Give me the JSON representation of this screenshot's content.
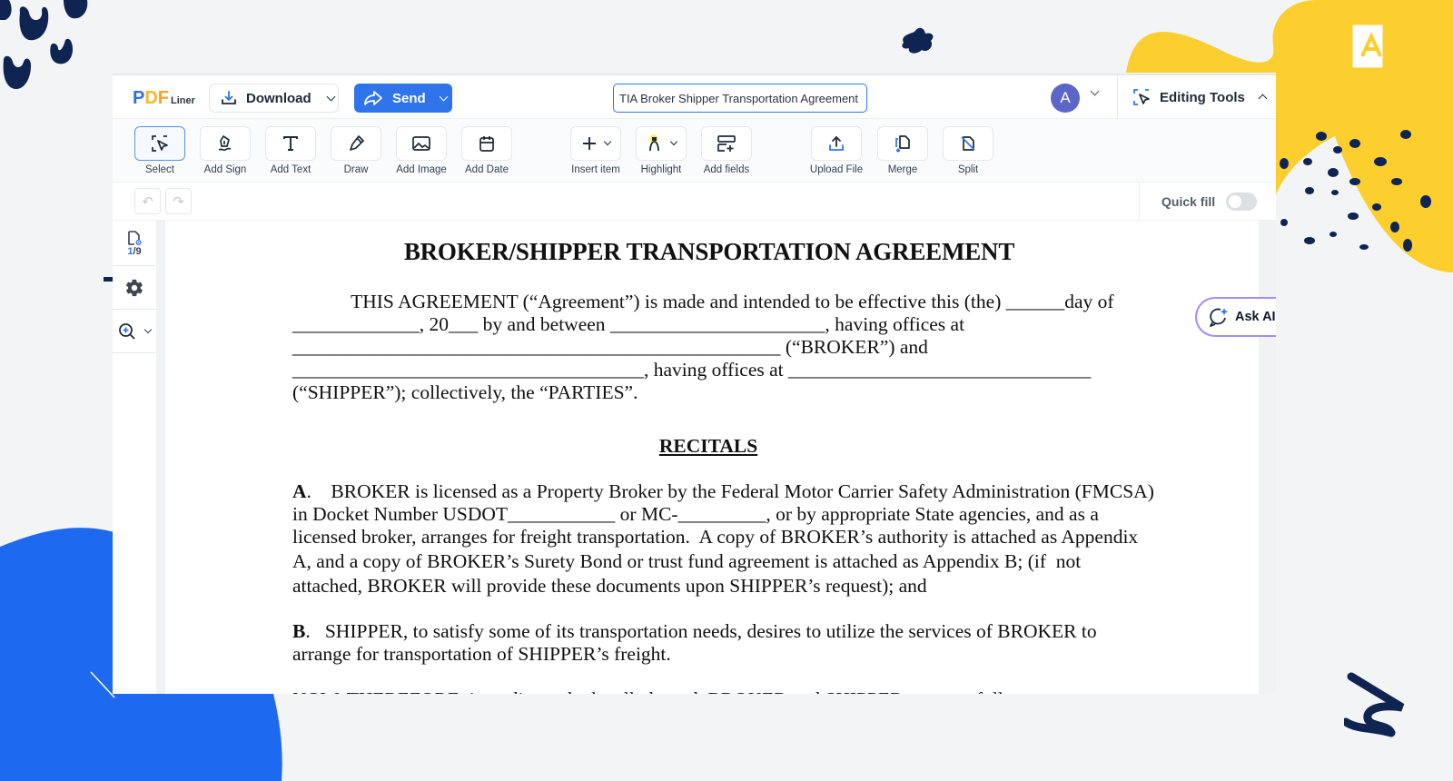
{
  "app": {
    "logo": {
      "p": "P",
      "d": "D",
      "f": "F",
      "suffix": "Liner"
    },
    "download_label": "Download",
    "send_label": "Send",
    "document_title": "TIA Broker Shipper Transportation Agreement",
    "avatar_initial": "A",
    "editing_tools_label": "Editing Tools",
    "accent_color": "#2f74eb"
  },
  "toolbar": {
    "tools": [
      {
        "label": "Select",
        "icon": "select-cursor-icon",
        "active": true
      },
      {
        "label": "Add Sign",
        "icon": "signature-pen-icon"
      },
      {
        "label": "Add Text",
        "icon": "text-t-icon"
      },
      {
        "label": "Draw",
        "icon": "pencil-draw-icon"
      },
      {
        "label": "Add Image",
        "icon": "image-icon"
      },
      {
        "label": "Add Date",
        "icon": "calendar-icon"
      },
      {
        "label": "Insert item",
        "icon": "plus-icon",
        "dropdown": true
      },
      {
        "label": "Highlight",
        "icon": "highlighter-icon",
        "dropdown": true
      },
      {
        "label": "Add fields",
        "icon": "form-fields-icon"
      },
      {
        "label": "Upload File",
        "icon": "upload-icon"
      },
      {
        "label": "Merge",
        "icon": "merge-icon"
      },
      {
        "label": "Split",
        "icon": "split-icon"
      }
    ]
  },
  "undobar": {
    "quick_fill_label": "Quick fill",
    "quick_fill_on": false
  },
  "sidebar": {
    "current_page": "1",
    "total_pages": "/9"
  },
  "ask_ai_label": "Ask AI",
  "document": {
    "title": "BROKER/SHIPPER TRANSPORTATION AGREEMENT",
    "intro_lines": [
      "            THIS AGREEMENT (“Agreement”) is made and intended to be effective this (the) ______day of",
      "_____________, 20___ by and between ______________________, having offices at",
      "__________________________________________________ (“BROKER”) and",
      "____________________________________, having offices at _______________________________",
      "(“SHIPPER”); collectively, the “PARTIES”."
    ],
    "recitals_heading": "RECITALS",
    "recital_a": {
      "letter": "A",
      "lines": [
        ".    BROKER is licensed as a Property Broker by the Federal Motor Carrier Safety Administration (FMCSA)",
        "in Docket Number USDOT___________ or MC-_________, or by appropriate State agencies, and as a",
        "licensed broker, arranges for freight transportation.  A copy of BROKER’s authority is attached as Appendix",
        "A, and a copy of BROKER’s Surety Bond or trust fund agreement is attached as Appendix B; (if  not",
        "attached, BROKER will provide these documents upon SHIPPER’s request); and"
      ]
    },
    "recital_b": {
      "letter": "B",
      "lines": [
        ".   SHIPPER, to satisfy some of its transportation needs, desires to utilize the services of BROKER to",
        "arrange for transportation of SHIPPER’s freight."
      ]
    },
    "cutoff_line": "NOW, THEREFORE, intending to be legally bound, BROKER and SHIPPER agree as follows:"
  }
}
